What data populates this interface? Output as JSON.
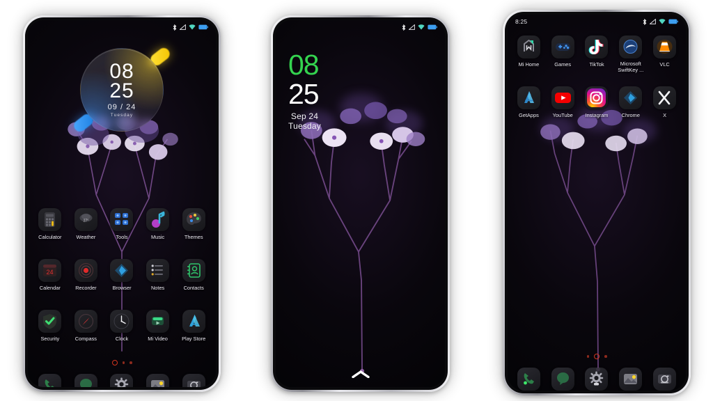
{
  "meta": {
    "accent_green": "#34d34f",
    "accent_yellow": "#ffd828",
    "accent_blue": "#3c96ff",
    "dot_red": "#d2341f",
    "background": "#ffffff"
  },
  "phone1": {
    "name": "Home screen with circular clock widget",
    "statusbar": {
      "clock": "",
      "icons": [
        "bluetooth-icon",
        "signal-icon",
        "wifi-icon",
        "battery-icon"
      ]
    },
    "widget": {
      "hours": "08",
      "minutes": "25",
      "date": "09 / 24",
      "weekday": "Tuesday"
    },
    "apps_row1": [
      {
        "label": "Calculator",
        "icon": "calculator-icon"
      },
      {
        "label": "Weather",
        "icon": "weather-icon"
      },
      {
        "label": "Tools",
        "icon": "tools-folder-icon"
      },
      {
        "label": "Music",
        "icon": "music-icon"
      },
      {
        "label": "Themes",
        "icon": "themes-icon"
      }
    ],
    "apps_row2": [
      {
        "label": "Calendar",
        "icon": "calendar-icon"
      },
      {
        "label": "Recorder",
        "icon": "recorder-icon"
      },
      {
        "label": "Browser",
        "icon": "browser-icon"
      },
      {
        "label": "Notes",
        "icon": "notes-icon"
      },
      {
        "label": "Contacts",
        "icon": "contacts-icon"
      }
    ],
    "apps_row3": [
      {
        "label": "Security",
        "icon": "security-icon"
      },
      {
        "label": "Compass",
        "icon": "compass-icon"
      },
      {
        "label": "Clock",
        "icon": "clock-icon"
      },
      {
        "label": "Mi Video",
        "icon": "mi-video-icon"
      },
      {
        "label": "Play Store",
        "icon": "play-store-icon"
      }
    ],
    "page_dots": {
      "count": 3,
      "active_index": 0
    },
    "dock": [
      {
        "label": "Phone",
        "icon": "phone-icon"
      },
      {
        "label": "Messages",
        "icon": "messages-icon"
      },
      {
        "label": "Settings",
        "icon": "settings-gear-icon"
      },
      {
        "label": "Gallery",
        "icon": "gallery-icon"
      },
      {
        "label": "Camera",
        "icon": "camera-icon"
      }
    ]
  },
  "phone2": {
    "name": "Lock screen",
    "statusbar": {
      "clock": "",
      "icons": [
        "bluetooth-icon",
        "signal-icon",
        "wifi-icon",
        "battery-icon"
      ]
    },
    "clock": {
      "hours": "08",
      "minutes": "25",
      "date": "Sep 24",
      "weekday": "Tuesday"
    },
    "unlock_hint": "chevron-up-icon"
  },
  "phone3": {
    "name": "Home screen page 2 with app icons",
    "statusbar": {
      "clock": "8:25",
      "icons": [
        "bluetooth-icon",
        "signal-icon",
        "wifi-icon",
        "battery-icon"
      ]
    },
    "apps_row1": [
      {
        "label": "Mi Home",
        "icon": "mi-home-icon"
      },
      {
        "label": "Games",
        "icon": "games-icon"
      },
      {
        "label": "TikTok",
        "icon": "tiktok-icon"
      },
      {
        "label": "Microsoft SwiftKey ...",
        "icon": "swiftkey-icon"
      },
      {
        "label": "VLC",
        "icon": "vlc-icon"
      }
    ],
    "apps_row2": [
      {
        "label": "GetApps",
        "icon": "getapps-icon"
      },
      {
        "label": "YouTube",
        "icon": "youtube-icon"
      },
      {
        "label": "Instagram",
        "icon": "instagram-icon"
      },
      {
        "label": "Chrome",
        "icon": "chrome-icon"
      },
      {
        "label": "X",
        "icon": "x-icon"
      }
    ],
    "page_dots": {
      "count": 3,
      "active_index": 1
    },
    "dock": [
      {
        "label": "Phone",
        "icon": "phone-icon"
      },
      {
        "label": "Messages",
        "icon": "messages-icon"
      },
      {
        "label": "Settings",
        "icon": "settings-gear-icon"
      },
      {
        "label": "Gallery",
        "icon": "gallery-icon"
      },
      {
        "label": "Camera",
        "icon": "camera-icon"
      }
    ]
  }
}
